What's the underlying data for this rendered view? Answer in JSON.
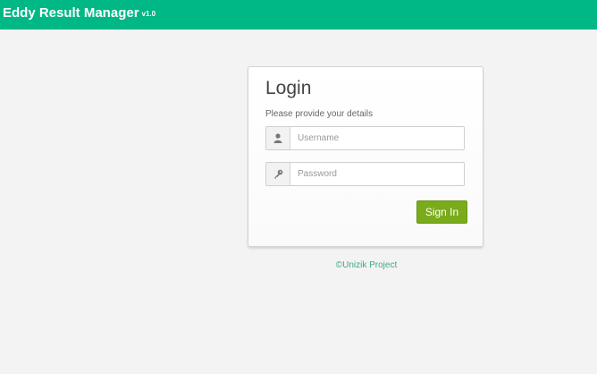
{
  "header": {
    "brand": "Eddy Result Manager",
    "version": "v1.0",
    "color": "#00b786"
  },
  "login": {
    "title": "Login",
    "subtitle": "Please provide your details",
    "username_placeholder": "Username",
    "username_icon": "user-icon",
    "password_placeholder": "Password",
    "password_icon": "key-icon",
    "signin_label": "Sign In",
    "signin_color": "#7aab1a"
  },
  "footer": {
    "text": "©Unizik Project"
  }
}
